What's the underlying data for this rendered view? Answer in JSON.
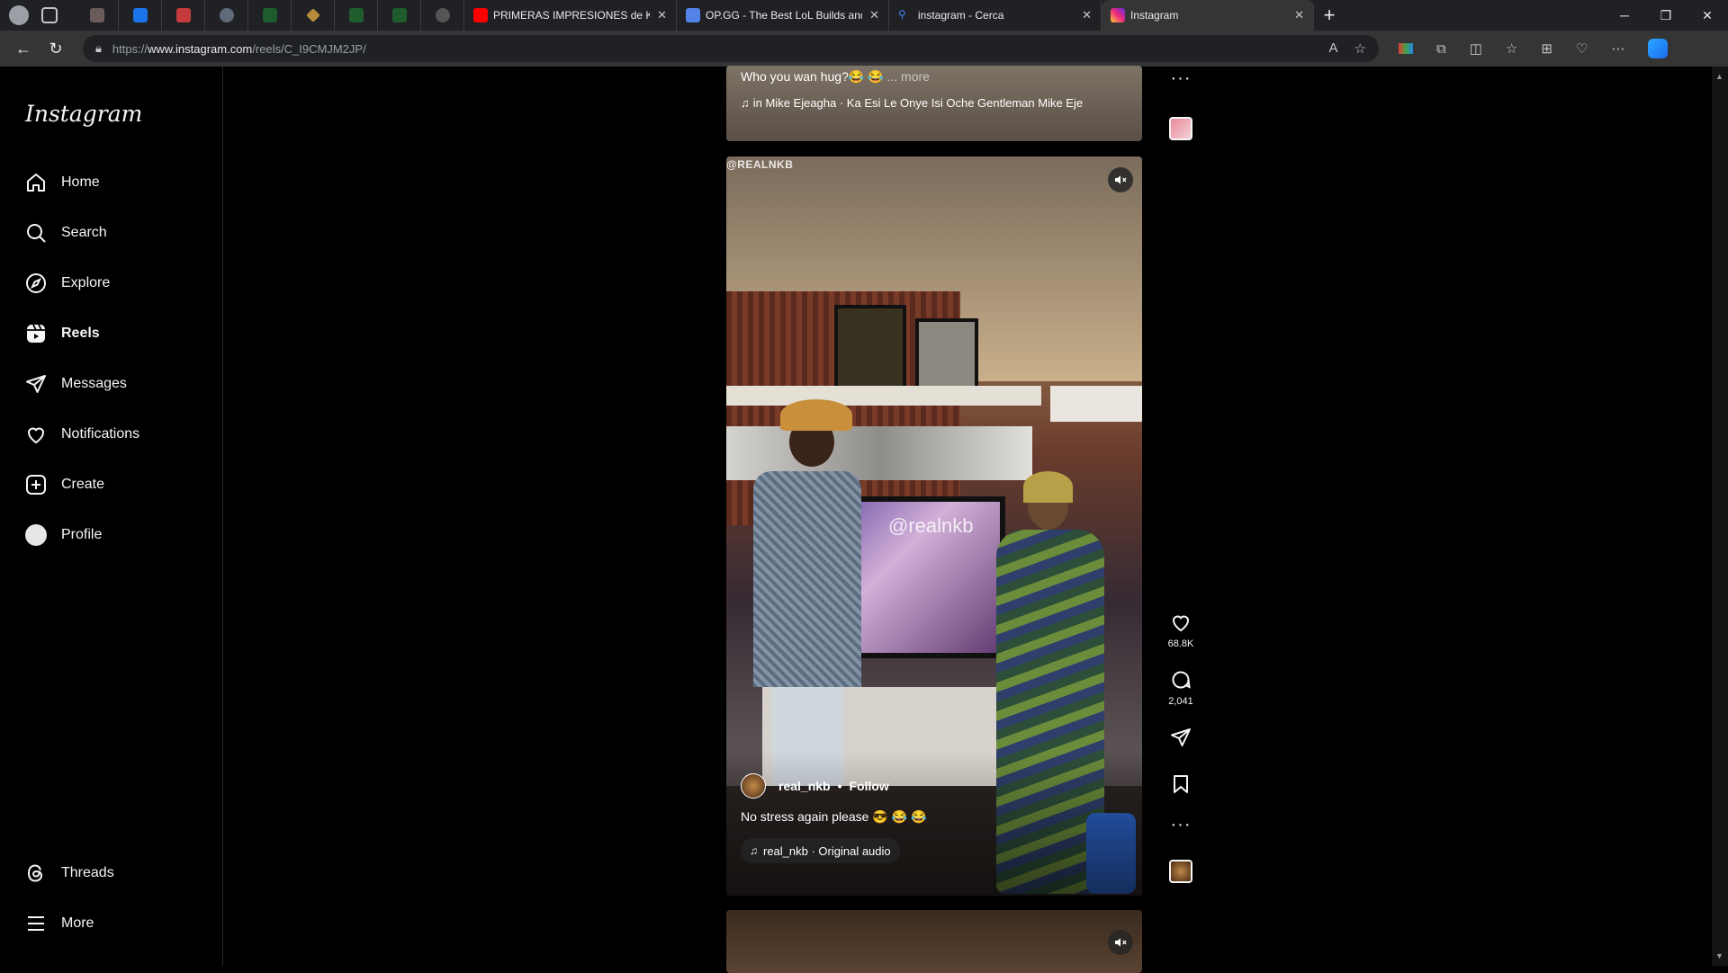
{
  "browser": {
    "tabs": [
      {
        "title": "PRIMERAS IMPRESIONES de K",
        "icon": "youtube-icon",
        "color": "#ff0000"
      },
      {
        "title": "OP.GG - The Best LoL Builds and",
        "icon": "opgg-icon",
        "color": "#5383e8"
      },
      {
        "title": "instagram - Cerca",
        "icon": "search-icon",
        "color": "#3b82f6"
      },
      {
        "title": "Instagram",
        "icon": "instagram-icon",
        "color": "#e1306c"
      }
    ],
    "url_prefix": "https://",
    "url_host": "www.instagram.com",
    "url_path": "/reels/C_I9CMJM2JP/"
  },
  "sidebar": {
    "logo": "Instagram",
    "items": [
      {
        "label": "Home",
        "icon": "home-icon"
      },
      {
        "label": "Search",
        "icon": "search-icon"
      },
      {
        "label": "Explore",
        "icon": "compass-icon"
      },
      {
        "label": "Reels",
        "icon": "reels-icon"
      },
      {
        "label": "Messages",
        "icon": "messages-icon"
      },
      {
        "label": "Notifications",
        "icon": "heart-icon"
      },
      {
        "label": "Create",
        "icon": "plus-square-icon"
      },
      {
        "label": "Profile",
        "icon": "avatar"
      }
    ],
    "bottom": [
      {
        "label": "Threads",
        "icon": "threads-icon"
      },
      {
        "label": "More",
        "icon": "menu-icon"
      }
    ]
  },
  "reels": {
    "previous": {
      "caption": "Who you wan hug?😂 😂",
      "more": "... more",
      "audio": "in Mike Ejeagha · Ka Esi Le Onye Isi Oche  Gentleman Mike Eje"
    },
    "current": {
      "watermark_top": "@REALNKB",
      "watermark_mid": "@realnkb",
      "username": "real_nkb",
      "follow_label": "Follow",
      "caption": "No stress again please 😎 😂 😂",
      "audio": "real_nkb · Original audio",
      "likes": "68.8K",
      "comments": "2,041"
    }
  }
}
